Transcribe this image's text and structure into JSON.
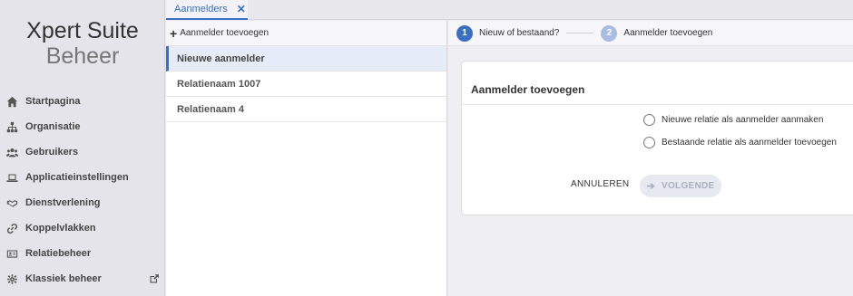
{
  "brand": {
    "line1": "Xpert Suite",
    "line2": "Beheer"
  },
  "sidebar": {
    "items": [
      {
        "label": "Startpagina",
        "icon": "home-icon"
      },
      {
        "label": "Organisatie",
        "icon": "org-chart-icon"
      },
      {
        "label": "Gebruikers",
        "icon": "users-icon"
      },
      {
        "label": "Applicatieinstellingen",
        "icon": "laptop-icon"
      },
      {
        "label": "Dienstverlening",
        "icon": "handshake-icon"
      },
      {
        "label": "Koppelvlakken",
        "icon": "link-icon"
      },
      {
        "label": "Relatiebeheer",
        "icon": "id-card-icon"
      },
      {
        "label": "Klassiek beheer",
        "icon": "gear-icon",
        "trailing_icon": "external-link-icon"
      }
    ]
  },
  "tabs": [
    {
      "label": "Aanmelders",
      "close": "✕"
    }
  ],
  "list": {
    "add_label": "Aanmelder toevoegen",
    "items": [
      "Nieuwe aanmelder",
      "Relatienaam 1007",
      "Relatienaam 4"
    ]
  },
  "stepper": {
    "steps": [
      {
        "num": "1",
        "label": "Nieuw of bestaand?"
      },
      {
        "num": "2",
        "label": "Aanmelder toevoegen"
      }
    ]
  },
  "card": {
    "title": "Aanmelder toevoegen",
    "options": [
      "Nieuwe relatie als aanmelder aanmaken",
      "Bestaande relatie als aanmelder toevoegen"
    ],
    "cancel_label": "ANNULEREN",
    "next_label": "VOLGENDE"
  },
  "colors": {
    "accent": "#3a6fc4",
    "step_inactive": "#a9bde3",
    "sidebar_bg": "#e4e4ea"
  }
}
